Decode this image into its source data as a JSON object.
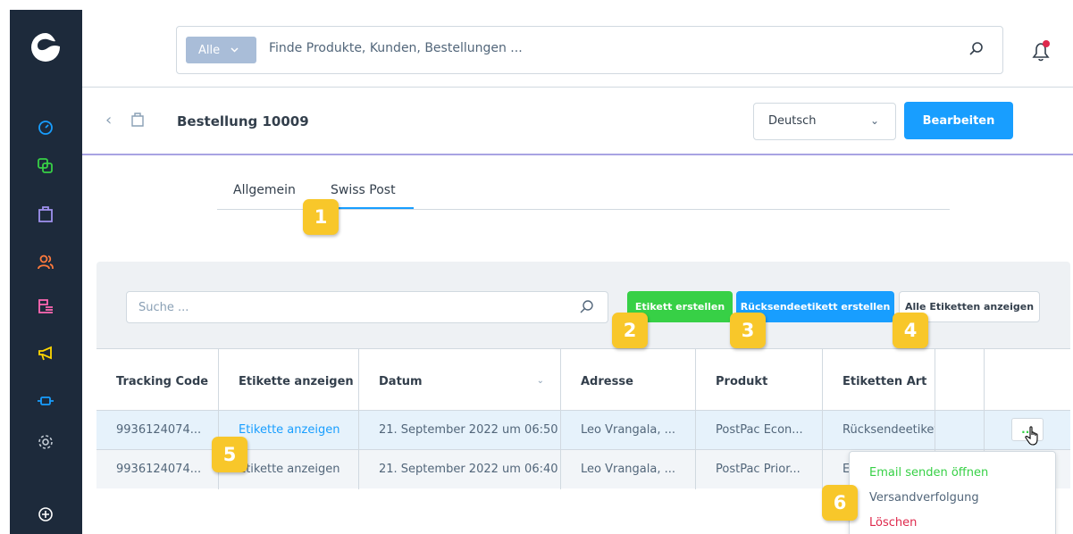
{
  "search": {
    "type_label": "Alle",
    "placeholder": "Finde Produkte, Kunden, Bestellungen ..."
  },
  "header": {
    "title": "Bestellung 10009",
    "language": "Deutsch",
    "edit_label": "Bearbeiten"
  },
  "tabs": [
    {
      "label": "Allgemein",
      "active": false
    },
    {
      "label": "Swiss Post",
      "active": true
    }
  ],
  "toolbar": {
    "search_placeholder": "Suche ...",
    "create_label": "Etikett erstellen",
    "return_label": "Rücksendeetikett erstellen",
    "all_label": "Alle Etiketten anzeigen"
  },
  "table": {
    "columns": [
      "Tracking Code",
      "Etikette anzeigen",
      "Datum",
      "Adresse",
      "Produkt",
      "Etiketten Art"
    ],
    "rows": [
      {
        "tracking": "9936124074...",
        "view": "Etikette anzeigen",
        "date": "21. September 2022 um 06:50",
        "address": "Leo Vrangala, ...",
        "product": "PostPac Econ...",
        "type": "Rücksendeetikett"
      },
      {
        "tracking": "9936124074...",
        "view": "Etikette anzeigen",
        "date": "21. September 2022 um 06:40",
        "address": "Leo Vrangala, ...",
        "product": "PostPac Prior...",
        "type": "E"
      }
    ]
  },
  "row_actions_label": "...",
  "context_menu": [
    {
      "label": "Email senden öffnen",
      "color": "#37d046"
    },
    {
      "label": "Versandverfolgung",
      "color": "#52667a"
    },
    {
      "label": "Löschen",
      "color": "#de294c"
    }
  ],
  "badges": [
    "1",
    "2",
    "3",
    "4",
    "5",
    "6"
  ],
  "colors": {
    "sidebar": "#1d2a3b",
    "primary": "#189eff",
    "success": "#37d046",
    "badge": "#f8c72a",
    "danger": "#de294c"
  },
  "icons": {
    "sidebar": [
      "dashboard-icon",
      "catalogue-icon",
      "orders-icon",
      "customers-icon",
      "content-icon",
      "marketing-icon",
      "extensions-icon",
      "settings-icon",
      "add-icon"
    ]
  }
}
